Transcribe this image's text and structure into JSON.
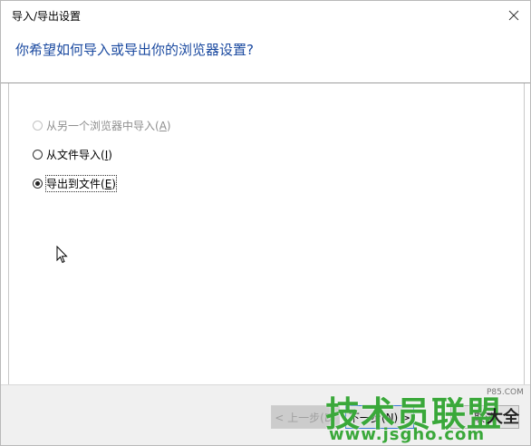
{
  "window": {
    "title": "导入/导出设置",
    "close_glyph": "✕"
  },
  "header": {
    "question": "你希望如何导入或导出你的浏览器设置?"
  },
  "options": [
    {
      "label": "从另一个浏览器中导入(",
      "mnemonic": "A",
      "suffix": ")",
      "checked": false,
      "disabled": true
    },
    {
      "label": "从文件导入(",
      "mnemonic": "I",
      "suffix": ")",
      "checked": false,
      "disabled": false
    },
    {
      "label": "导出到文件(",
      "mnemonic": "E",
      "suffix": ")",
      "checked": true,
      "disabled": false
    }
  ],
  "footer": {
    "back_label": "< 上一步(B)",
    "next_label": "下一步(N) >",
    "cancel_label": "取消"
  },
  "watermark": {
    "main": "技术员联盟",
    "url": "www.jsgho.com",
    "side": "大全",
    "side_url": "P85.COM"
  },
  "icons": {
    "close": "close-icon",
    "cursor": "arrow-cursor-icon"
  }
}
